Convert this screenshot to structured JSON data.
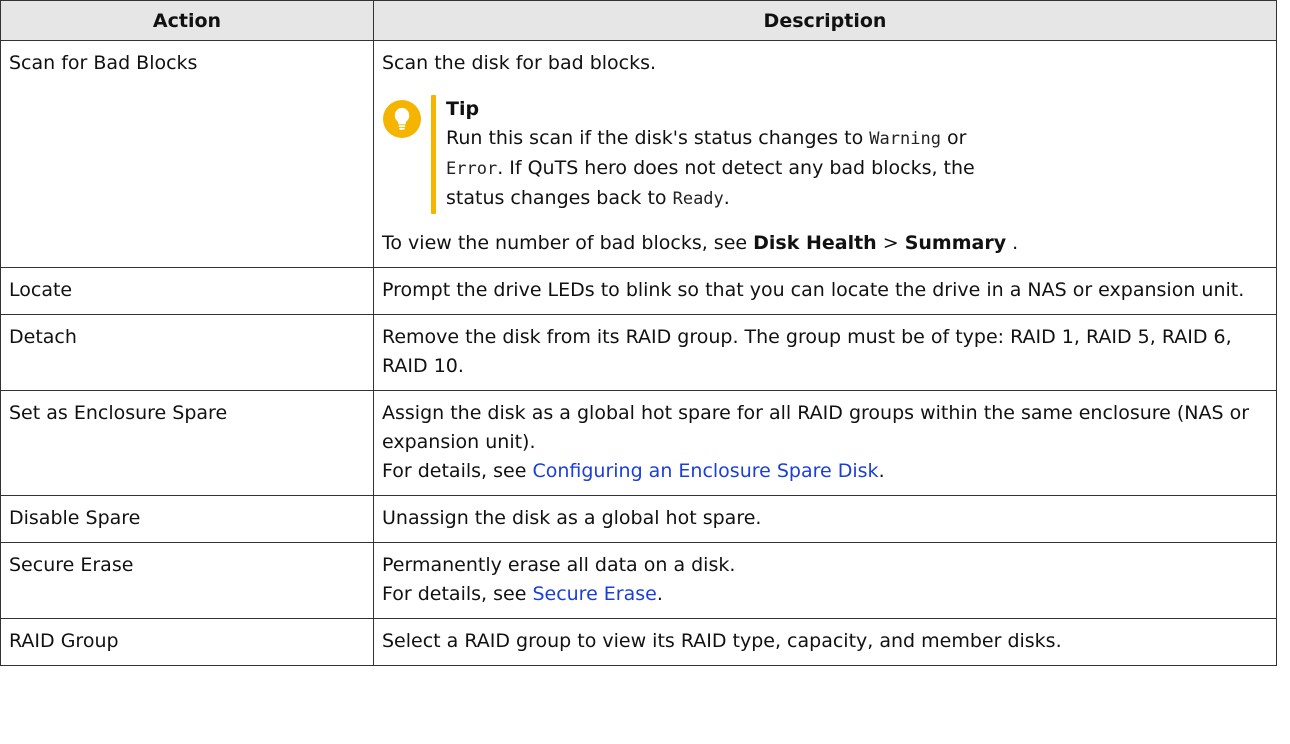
{
  "headers": {
    "action": "Action",
    "description": "Description"
  },
  "rows": {
    "scan": {
      "action": "Scan for Bad Blocks",
      "line1": "Scan the disk for bad blocks.",
      "tip": {
        "icon": "lightbulb-icon",
        "title": "Tip",
        "t1": "Run this scan if the disk's status changes to ",
        "code1": "Warning",
        "t2": " or ",
        "code2": "Error",
        "t3": ". If QuTS hero does not detect any bad blocks, the status changes back to ",
        "code3": "Ready",
        "t4": "."
      },
      "footer": {
        "pre": "To view the number of bad blocks, see ",
        "b1": "Disk Health",
        "sep": " > ",
        "b2": "Summary",
        "post": " ."
      }
    },
    "locate": {
      "action": "Locate",
      "desc": "Prompt the drive LEDs to blink so that you can locate the drive in a NAS or expansion unit."
    },
    "detach": {
      "action": "Detach",
      "desc": "Remove the disk from its RAID group. The group must be of type: RAID 1, RAID 5, RAID 6, RAID 10."
    },
    "enclosure": {
      "action": "Set as Enclosure Spare",
      "desc": "Assign the disk as a global hot spare for all RAID groups within the same enclosure (NAS or expansion unit).",
      "pre": "For details, see ",
      "link": "Configuring an Enclosure Spare Disk",
      "post": "."
    },
    "disable": {
      "action": "Disable Spare",
      "desc": "Unassign the disk as a global hot spare."
    },
    "erase": {
      "action": "Secure Erase",
      "desc": "Permanently erase all data on a disk.",
      "pre": "For details, see ",
      "link": "Secure Erase",
      "post": "."
    },
    "raid": {
      "action": "RAID Group",
      "desc": "Select a RAID group to view its RAID type, capacity, and member disks."
    }
  },
  "colors": {
    "tip_accent": "#f5b400",
    "link": "#1a3edb",
    "header_bg": "#e6e6e6"
  }
}
